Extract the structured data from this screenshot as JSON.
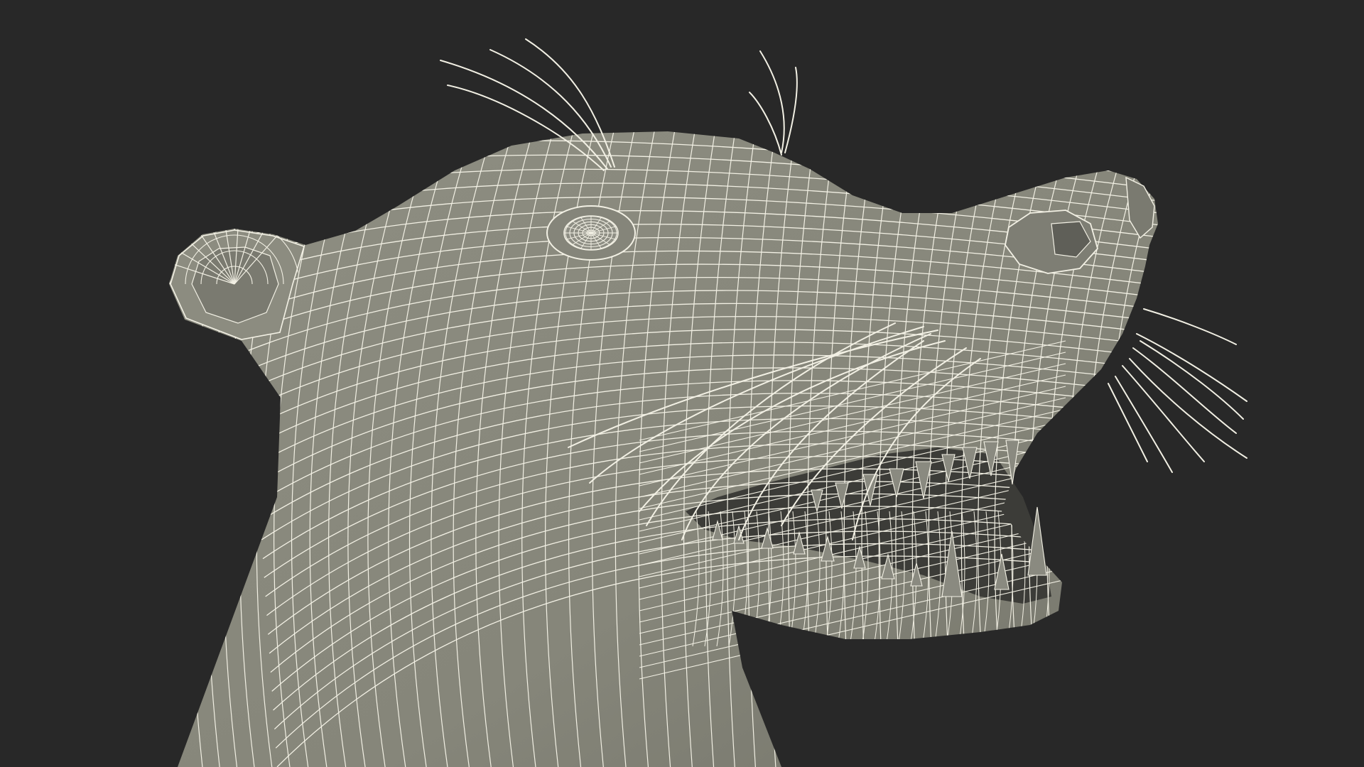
{
  "scene": {
    "subject": "wireframe-animal-head",
    "render_style": "wireframe",
    "background_color": "#282828",
    "surface_color": "#8a8a7e",
    "surface_shade_color": "#6e6e64",
    "wire_color": "#f2f0e4",
    "mouth_color": "#3a3a36"
  }
}
